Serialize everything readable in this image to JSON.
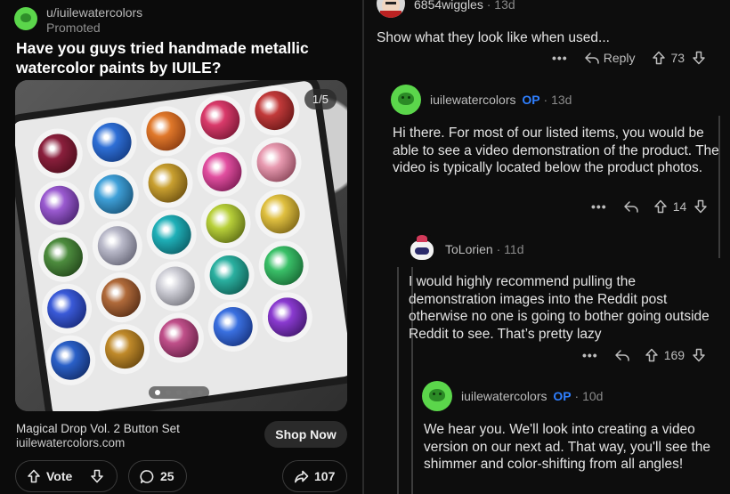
{
  "ad": {
    "username": "u/iuilewatercolors",
    "promoted": "Promoted",
    "title": "Have you guys tried handmade metallic watercolor paints by IUILE?",
    "image_counter": "1/5",
    "carousel": {
      "total_dots": 5,
      "active_index": 0
    },
    "caption_name": "Magical Drop Vol. 2 Button Set",
    "caption_site": "iuilewatercolors.com",
    "shop_label": "Shop Now",
    "vote_label": "Vote",
    "comment_count": "25",
    "share_count": "107"
  },
  "comments": [
    {
      "username": "6854wiggles",
      "age": "13d",
      "body": "Show what they look like when used...",
      "reply_label": "Reply",
      "score": "73",
      "more": "•••"
    },
    {
      "username": "iuilewatercolors",
      "op_badge": "OP",
      "age": "13d",
      "body": "Hi there. For most of our listed items, you would be able to see a video demonstration of the product. The video is typically located below the product photos.",
      "score": "14",
      "more": "•••"
    },
    {
      "username": "ToLorien",
      "age": "11d",
      "body": "I would highly recommend pulling the demonstration images into the Reddit post otherwise no one is going to bother going outside Reddit to see. That’s pretty lazy",
      "score": "169",
      "more": "•••"
    },
    {
      "username": "iuilewatercolors",
      "op_badge": "OP",
      "age": "10d",
      "body": "We hear you. We'll look into creating a video version on our next ad. That way, you'll see the shimmer and color-shifting from all angles!"
    }
  ],
  "separator": "·",
  "colors": {
    "background": "#000000",
    "op_badge": "#2f7fff",
    "avatar_green": "#5bd64b",
    "text_primary": "#e4e4e4",
    "text_muted": "#8a8a8a"
  },
  "icons": [
    "upvote-icon",
    "downvote-icon",
    "comment-icon",
    "share-icon",
    "reply-icon",
    "more-icon"
  ]
}
